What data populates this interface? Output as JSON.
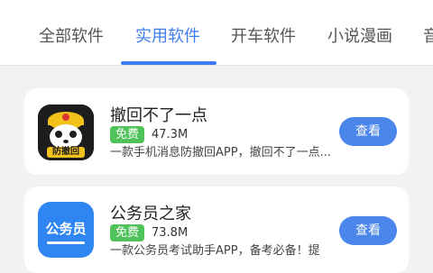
{
  "tabs": [
    {
      "label": "全部软件"
    },
    {
      "label": "实用软件"
    },
    {
      "label": "开车软件"
    },
    {
      "label": "小说漫画"
    },
    {
      "label": "音"
    }
  ],
  "active_tab": "实用软件",
  "apps": [
    {
      "name": "撤回不了一点",
      "badge": "免费",
      "size": "47.3M",
      "description": "一款手机消息防撤回APP，撤回不了一点...",
      "icon_text": "防撤回",
      "button": "查看"
    },
    {
      "name": "公务员之家",
      "badge": "免费",
      "size": "73.8M",
      "description": "一款公务员考试助手APP，备考必备！提",
      "icon_text": "公务员",
      "button": "查看"
    }
  ],
  "colors": {
    "accent": "#3d7cf0",
    "badge": "#4fc35a",
    "button": "#4a86ec"
  }
}
